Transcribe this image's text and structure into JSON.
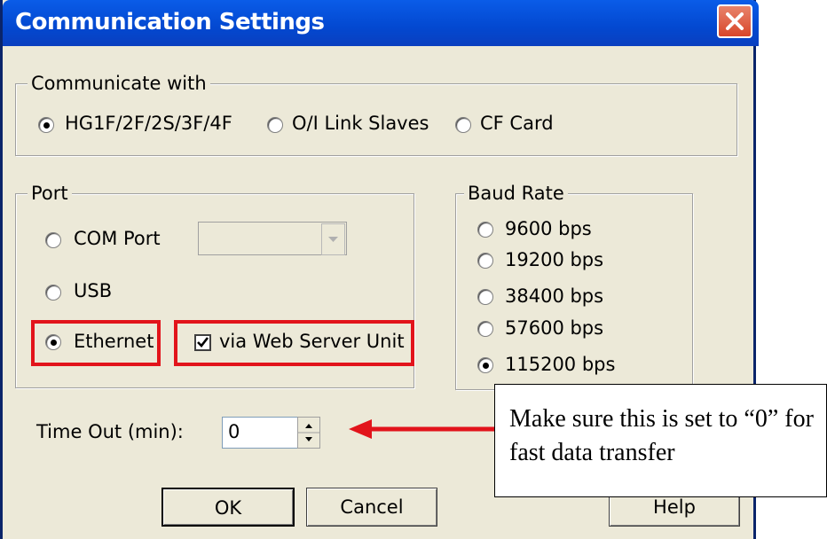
{
  "window": {
    "title": "Communication Settings"
  },
  "communicate_with": {
    "legend": "Communicate with",
    "options": [
      {
        "label": "HG1F/2F/2S/3F/4F",
        "selected": true
      },
      {
        "label": "O/I Link Slaves",
        "selected": false
      },
      {
        "label": "CF Card",
        "selected": false
      }
    ]
  },
  "port": {
    "legend": "Port",
    "com_port_label": "COM Port",
    "com_port_value": "",
    "usb_label": "USB",
    "ethernet_label": "Ethernet",
    "selected": "Ethernet",
    "web_server_label": "via Web Server Unit",
    "web_server_checked": true
  },
  "baud_rate": {
    "legend": "Baud Rate",
    "options": [
      {
        "label": "9600 bps",
        "selected": false
      },
      {
        "label": "19200 bps",
        "selected": false
      },
      {
        "label": "38400 bps",
        "selected": false
      },
      {
        "label": "57600 bps",
        "selected": false
      },
      {
        "label": "115200 bps",
        "selected": true
      }
    ]
  },
  "timeout": {
    "label": "Time Out (min):",
    "value": "0"
  },
  "buttons": {
    "ok": "OK",
    "cancel": "Cancel",
    "help": "Help"
  },
  "annotation": {
    "text": "Make sure this is set to “0” for fast data transfer",
    "highlight_color": "#e2141b"
  }
}
